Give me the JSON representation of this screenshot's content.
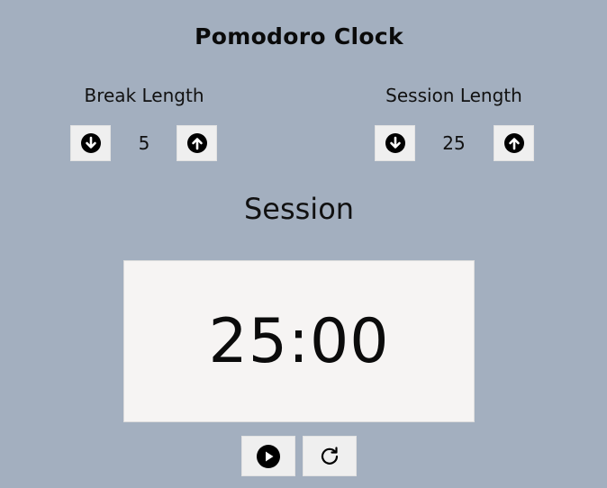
{
  "app": {
    "title": "Pomodoro Clock"
  },
  "break": {
    "label": "Break Length",
    "value": "5",
    "decrement_icon": "arrow-down-circle-icon",
    "increment_icon": "arrow-up-circle-icon"
  },
  "session": {
    "label": "Session Length",
    "value": "25",
    "decrement_icon": "arrow-down-circle-icon",
    "increment_icon": "arrow-up-circle-icon"
  },
  "timer": {
    "mode_label": "Session",
    "time": "25:00"
  },
  "controls": {
    "start_icon": "play-circle-icon",
    "reset_icon": "refresh-icon"
  },
  "colors": {
    "background": "#a3afbf",
    "button_bg": "#efefef",
    "timer_bg": "#f6f4f3",
    "text": "#111111"
  }
}
